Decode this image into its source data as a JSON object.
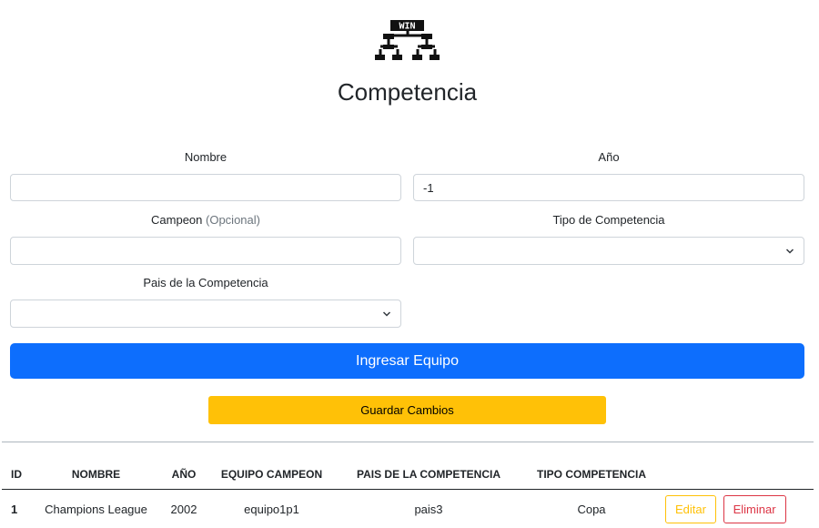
{
  "header": {
    "logo_text": "WIN",
    "title": "Competencia"
  },
  "form": {
    "nombre": {
      "label": "Nombre",
      "value": "",
      "placeholder": ""
    },
    "anio": {
      "label": "Año",
      "value": "-1"
    },
    "campeon": {
      "label": "Campeon",
      "optional": "(Opcional)",
      "value": ""
    },
    "tipo": {
      "label": "Tipo de Competencia",
      "selected": ""
    },
    "pais": {
      "label": "Pais de la Competencia",
      "selected": ""
    }
  },
  "buttons": {
    "submit_label": "Ingresar Equipo",
    "save_label": "Guardar Cambios"
  },
  "table": {
    "headers": [
      "ID",
      "NOMBRE",
      "AÑO",
      "EQUIPO CAMPEON",
      "PAIS DE LA COMPETENCIA",
      "TIPO COMPETENCIA",
      ""
    ],
    "rows": [
      {
        "id": "1",
        "nombre": "Champions League",
        "anio": "2002",
        "equipo": "equipo1p1",
        "pais": "pais3",
        "tipo": "Copa",
        "edit_label": "Editar",
        "delete_label": "Eliminar"
      }
    ]
  },
  "colors": {
    "primary": "#0d6efd",
    "warning": "#ffc107",
    "danger": "#dc3545"
  }
}
